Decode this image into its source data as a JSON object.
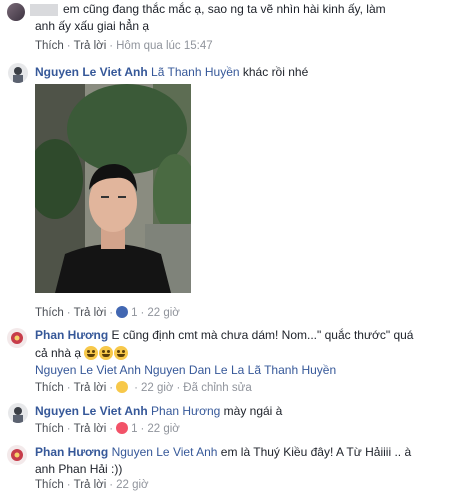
{
  "comment1": {
    "line1": "em cũng đang thắc mắc ạ, sao ng ta vẽ nhìn hài kinh ấy, làm",
    "line2": "anh ấy xấu giai hẳn ạ",
    "like": "Thích",
    "reply": "Trả lời",
    "time": "Hôm qua lúc 15:47"
  },
  "comment2": {
    "author": "Nguyen Le Viet Anh",
    "mention": "Lã Thanh Huyền",
    "text": " khác rồi nhé",
    "like": "Thích",
    "reply": "Trả lời",
    "reaction_count": "1",
    "time": "22 giờ"
  },
  "comment3": {
    "author": "Phan Hương",
    "text1": " E cũng định cmt mà chưa dám! Nom...\" quắc thước\" quá",
    "text2": "cả nhà ạ",
    "tags": [
      "Nguyen Le Viet Anh",
      "Nguyen Dan Le La",
      "Lã Thanh Huyền"
    ],
    "like": "Thích",
    "reply": "Trả lời",
    "time": "22 giờ",
    "edited": "Đã chỉnh sửa"
  },
  "comment4": {
    "author": "Nguyen Le Viet Anh",
    "mention": "Phan Hương",
    "text": " mày ngái à",
    "like": "Thích",
    "reply": "Trả lời",
    "reaction_count": "1",
    "time": "22 giờ"
  },
  "comment5": {
    "author": "Phan Hương",
    "mention": "Nguyen Le Viet Anh",
    "text1": " em là Thuý Kiều đây! A Từ Hảiiii .. à",
    "text2": "anh Phan Hải :))",
    "like": "Thích",
    "reply": "Trả lời",
    "time": "22 giờ"
  },
  "colors": {
    "link": "#365899",
    "text": "#1d2129",
    "meta": "#90949c",
    "like_blue": "#4267b2",
    "love_red": "#f25268"
  }
}
